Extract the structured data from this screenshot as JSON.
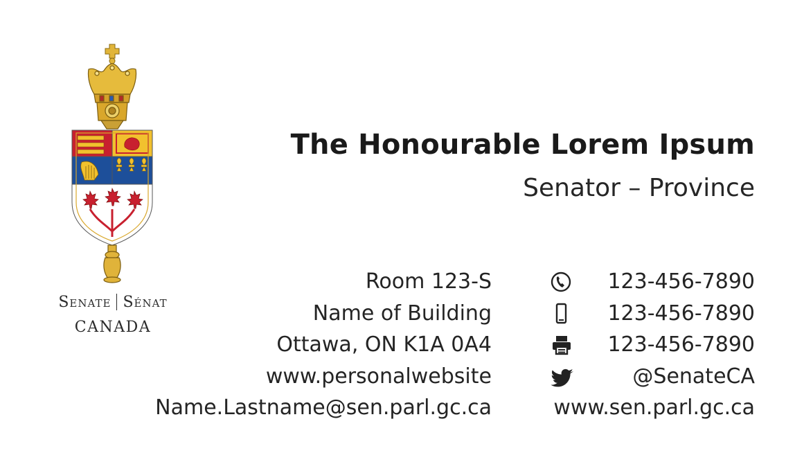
{
  "logo": {
    "line1_left": "Senate",
    "line1_right": "Sénat",
    "line2": "CANADA",
    "emblem_icon": "senate-mace-coat-of-arms-icon"
  },
  "person": {
    "name": "The Honourable Lorem Ipsum",
    "title": "Senator – Province"
  },
  "address": [
    "Room 123-S",
    "Name of Building",
    "Ottawa, ON  K1A 0A4",
    "www.personalwebsite",
    "Name.Lastname@sen.parl.gc.ca"
  ],
  "contacts": [
    {
      "icon": "phone-icon",
      "value": "123-456-7890"
    },
    {
      "icon": "mobile-phone-icon",
      "value": "123-456-7890"
    },
    {
      "icon": "fax-printer-icon",
      "value": "123-456-7890"
    },
    {
      "icon": "twitter-icon",
      "value": "@SenateCA"
    },
    {
      "icon": "",
      "value": "www.sen.parl.gc.ca"
    }
  ],
  "colors": {
    "text": "#1e1e1e",
    "gold": "#d9a72b",
    "red": "#c8202f",
    "blue": "#1d4f9a",
    "background": "#ffffff"
  }
}
